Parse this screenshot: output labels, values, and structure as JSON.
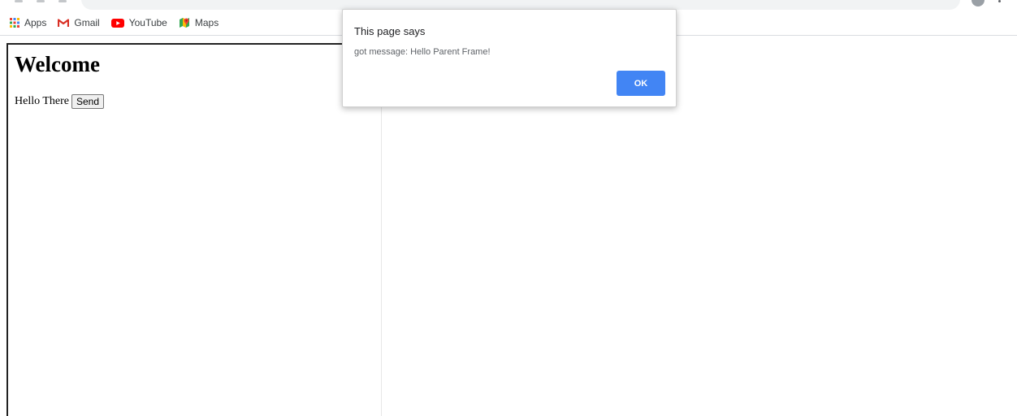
{
  "bookmarks": [
    {
      "label": "Apps",
      "icon": "apps-grid-icon"
    },
    {
      "label": "Gmail",
      "icon": "gmail-icon"
    },
    {
      "label": "YouTube",
      "icon": "youtube-icon"
    },
    {
      "label": "Maps",
      "icon": "maps-icon"
    }
  ],
  "iframe": {
    "heading": "Welcome",
    "text": "Hello There",
    "send_label": "Send"
  },
  "dialog": {
    "title": "This page says",
    "message": "got message: Hello Parent Frame!",
    "ok_label": "OK"
  },
  "colors": {
    "ok_button": "#4285f4",
    "gmail_red": "#d93025",
    "youtube_red": "#ff0000"
  }
}
